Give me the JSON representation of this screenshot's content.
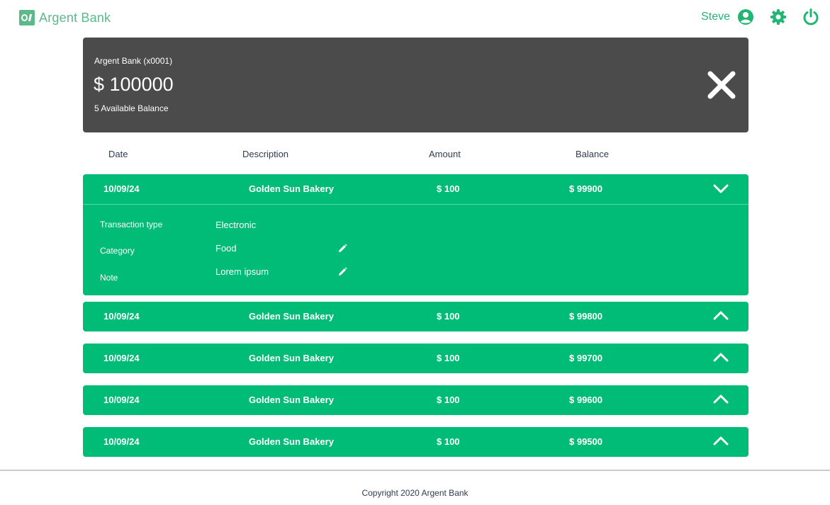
{
  "brand": {
    "name": "Argent Bank",
    "color": "#5cb98a"
  },
  "header": {
    "user_name": "Steve",
    "icons": [
      "user-circle-icon",
      "gear-icon",
      "power-icon"
    ],
    "accent": "#22b573"
  },
  "account": {
    "title": "Argent Bank (x0001)",
    "amount": "$ 100000",
    "description": "5 Available Balance",
    "background": "#4a4b4a"
  },
  "columns": [
    "Date",
    "Description",
    "Amount",
    "Balance"
  ],
  "transactions": [
    {
      "date": "10/09/24",
      "description": "Golden Sun Bakery",
      "amount": "$ 100",
      "balance": "$ 99900",
      "expanded": true,
      "details": {
        "type_label": "Transaction type",
        "type_value": "Electronic",
        "category_label": "Category",
        "category_value": "Food",
        "note_label": "Note",
        "note_value": "Lorem ipsum"
      }
    },
    {
      "date": "10/09/24",
      "description": "Golden Sun Bakery",
      "amount": "$ 100",
      "balance": "$ 99800",
      "expanded": false
    },
    {
      "date": "10/09/24",
      "description": "Golden Sun Bakery",
      "amount": "$ 100",
      "balance": "$ 99700",
      "expanded": false
    },
    {
      "date": "10/09/24",
      "description": "Golden Sun Bakery",
      "amount": "$ 100",
      "balance": "$ 99600",
      "expanded": false
    },
    {
      "date": "10/09/24",
      "description": "Golden Sun Bakery",
      "amount": "$ 100",
      "balance": "$ 99500",
      "expanded": false
    }
  ],
  "colors": {
    "transaction_bg": "#00bc77"
  },
  "footer": {
    "copyright": "Copyright 2020 Argent Bank"
  }
}
